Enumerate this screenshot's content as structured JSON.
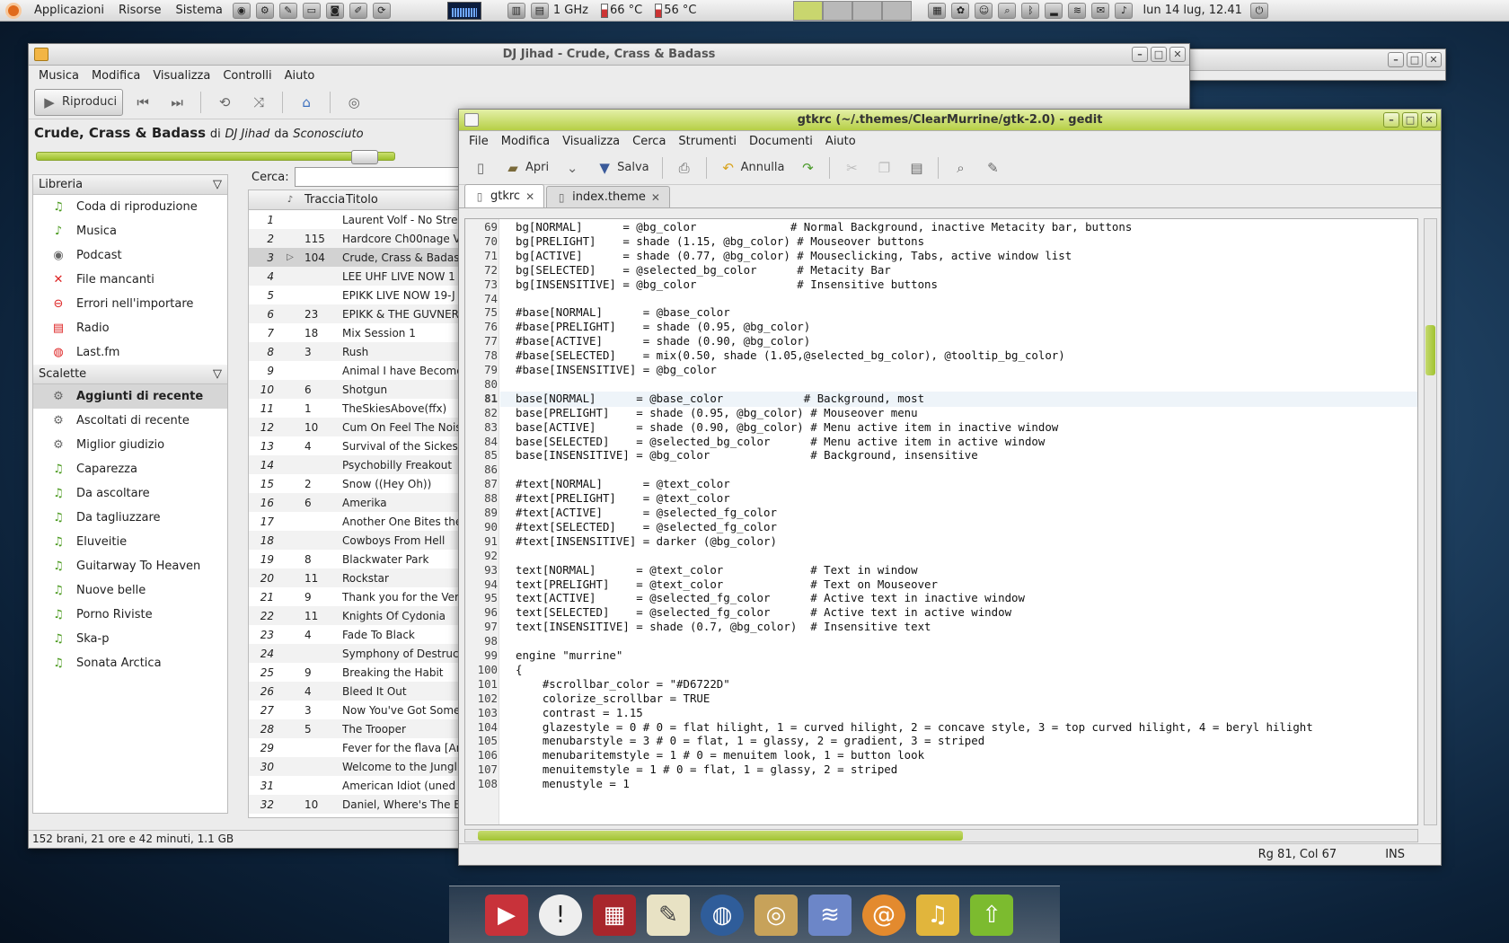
{
  "panel": {
    "menus": [
      "Applicazioni",
      "Risorse",
      "Sistema"
    ],
    "cpu": "1 GHz",
    "temp1": "66 °C",
    "temp2": "56 °C",
    "clock": "lun 14 lug, 12.41"
  },
  "rhythmbox": {
    "title": "DJ Jihad - Crude, Crass & Badass",
    "menu": [
      "Musica",
      "Modifica",
      "Visualizza",
      "Controlli",
      "Aiuto"
    ],
    "play_label": "Riproduci",
    "now_playing": {
      "song": "Crude, Crass & Badass",
      "by": "di",
      "artist": "DJ Jihad",
      "from": "da",
      "album": "Sconosciuto"
    },
    "library_header": "Libreria",
    "library": [
      {
        "label": "Coda di riproduzione",
        "icon": "queue-icon"
      },
      {
        "label": "Musica",
        "icon": "music-note-icon"
      },
      {
        "label": "Podcast",
        "icon": "podcast-icon"
      },
      {
        "label": "File mancanti",
        "icon": "missing-file-icon"
      },
      {
        "label": "Errori nell'importare",
        "icon": "error-icon"
      },
      {
        "label": "Radio",
        "icon": "radio-icon"
      },
      {
        "label": "Last.fm",
        "icon": "lastfm-icon"
      }
    ],
    "playlists_header": "Scalette",
    "playlists": [
      {
        "label": "Aggiunti di recente",
        "icon": "gear-icon",
        "selected": true
      },
      {
        "label": "Ascoltati di recente",
        "icon": "gear-icon"
      },
      {
        "label": "Miglior giudizio",
        "icon": "gear-icon"
      },
      {
        "label": "Caparezza",
        "icon": "playlist-icon"
      },
      {
        "label": "Da ascoltare",
        "icon": "playlist-icon"
      },
      {
        "label": "Da tagliuzzare",
        "icon": "playlist-icon"
      },
      {
        "label": "Eluveitie",
        "icon": "playlist-icon"
      },
      {
        "label": "Guitarway To Heaven",
        "icon": "playlist-icon"
      },
      {
        "label": "Nuove belle",
        "icon": "playlist-icon"
      },
      {
        "label": "Porno Riviste",
        "icon": "playlist-icon"
      },
      {
        "label": "Ska-p",
        "icon": "playlist-icon"
      },
      {
        "label": "Sonata Arctica",
        "icon": "playlist-icon"
      }
    ],
    "search_label": "Cerca:",
    "columns": {
      "track": "Traccia",
      "title": "Titolo"
    },
    "tracks": [
      {
        "n": "1",
        "track": "",
        "title": "Laurent Volf - No Stre"
      },
      {
        "n": "2",
        "track": "115",
        "title": "Hardcore Ch00nage V"
      },
      {
        "n": "3",
        "track": "104",
        "title": "Crude, Crass & Badas",
        "playing": true
      },
      {
        "n": "4",
        "track": "",
        "title": "LEE UHF LIVE NOW 1"
      },
      {
        "n": "5",
        "track": "",
        "title": "EPIKK LIVE NOW 19-J"
      },
      {
        "n": "6",
        "track": "23",
        "title": "EPIKK & THE GUVNER"
      },
      {
        "n": "7",
        "track": "18",
        "title": "Mix Session 1"
      },
      {
        "n": "8",
        "track": "3",
        "title": "Rush"
      },
      {
        "n": "9",
        "track": "",
        "title": "Animal I have Become"
      },
      {
        "n": "10",
        "track": "6",
        "title": "Shotgun"
      },
      {
        "n": "11",
        "track": "1",
        "title": "TheSkiesAbove(ffx)"
      },
      {
        "n": "12",
        "track": "10",
        "title": "Cum On Feel The Nois"
      },
      {
        "n": "13",
        "track": "4",
        "title": "Survival of the Sickes"
      },
      {
        "n": "14",
        "track": "",
        "title": "Psychobilly Freakout"
      },
      {
        "n": "15",
        "track": "2",
        "title": "Snow ((Hey Oh))"
      },
      {
        "n": "16",
        "track": "6",
        "title": "Amerika"
      },
      {
        "n": "17",
        "track": "",
        "title": "Another One Bites the"
      },
      {
        "n": "18",
        "track": "",
        "title": "Cowboys From Hell"
      },
      {
        "n": "19",
        "track": "8",
        "title": "Blackwater Park"
      },
      {
        "n": "20",
        "track": "11",
        "title": "Rockstar"
      },
      {
        "n": "21",
        "track": "9",
        "title": "Thank you for the Ver"
      },
      {
        "n": "22",
        "track": "11",
        "title": "Knights Of Cydonia"
      },
      {
        "n": "23",
        "track": "4",
        "title": "Fade To Black"
      },
      {
        "n": "24",
        "track": "",
        "title": "Symphony of Destruc"
      },
      {
        "n": "25",
        "track": "9",
        "title": "Breaking the Habit"
      },
      {
        "n": "26",
        "track": "4",
        "title": "Bleed It Out"
      },
      {
        "n": "27",
        "track": "3",
        "title": "Now You've Got Some"
      },
      {
        "n": "28",
        "track": "5",
        "title": "The Trooper"
      },
      {
        "n": "29",
        "track": "",
        "title": "Fever for the flava [Ar"
      },
      {
        "n": "30",
        "track": "",
        "title": "Welcome to the Jungl"
      },
      {
        "n": "31",
        "track": "",
        "title": "American Idiot (uned"
      },
      {
        "n": "32",
        "track": "10",
        "title": "Daniel, Where's The E"
      }
    ],
    "status": "152 brani, 21 ore e 42 minuti, 1.1 GB"
  },
  "gedit": {
    "title": "gtkrc (~/.themes/ClearMurrine/gtk-2.0) - gedit",
    "menu": [
      "File",
      "Modifica",
      "Visualizza",
      "Cerca",
      "Strumenti",
      "Documenti",
      "Aiuto"
    ],
    "toolbar": {
      "open": "Apri",
      "save": "Salva",
      "undo": "Annulla"
    },
    "tabs": [
      "gtkrc",
      "index.theme"
    ],
    "lines": [
      {
        "n": "69",
        "text": "bg[NORMAL]      = @bg_color              # Normal Background, inactive Metacity bar, buttons"
      },
      {
        "n": "70",
        "text": "bg[PRELIGHT]    = shade (1.15, @bg_color) # Mouseover buttons"
      },
      {
        "n": "71",
        "text": "bg[ACTIVE]      = shade (0.77, @bg_color) # Mouseclicking, Tabs, active window list"
      },
      {
        "n": "72",
        "text": "bg[SELECTED]    = @selected_bg_color      # Metacity Bar"
      },
      {
        "n": "73",
        "text": "bg[INSENSITIVE] = @bg_color               # Insensitive buttons"
      },
      {
        "n": "74",
        "text": ""
      },
      {
        "n": "75",
        "text": "#base[NORMAL]      = @base_color"
      },
      {
        "n": "76",
        "text": "#base[PRELIGHT]    = shade (0.95, @bg_color)"
      },
      {
        "n": "77",
        "text": "#base[ACTIVE]      = shade (0.90, @bg_color)"
      },
      {
        "n": "78",
        "text": "#base[SELECTED]    = mix(0.50, shade (1.05,@selected_bg_color), @tooltip_bg_color)"
      },
      {
        "n": "79",
        "text": "#base[INSENSITIVE] = @bg_color"
      },
      {
        "n": "80",
        "text": ""
      },
      {
        "n": "81",
        "text": "base[NORMAL]      = @base_color            # Background, most",
        "current": true
      },
      {
        "n": "82",
        "text": "base[PRELIGHT]    = shade (0.95, @bg_color) # Mouseover menu"
      },
      {
        "n": "83",
        "text": "base[ACTIVE]      = shade (0.90, @bg_color) # Menu active item in inactive window"
      },
      {
        "n": "84",
        "text": "base[SELECTED]    = @selected_bg_color      # Menu active item in active window"
      },
      {
        "n": "85",
        "text": "base[INSENSITIVE] = @bg_color               # Background, insensitive"
      },
      {
        "n": "86",
        "text": ""
      },
      {
        "n": "87",
        "text": "#text[NORMAL]      = @text_color"
      },
      {
        "n": "88",
        "text": "#text[PRELIGHT]    = @text_color"
      },
      {
        "n": "89",
        "text": "#text[ACTIVE]      = @selected_fg_color"
      },
      {
        "n": "90",
        "text": "#text[SELECTED]    = @selected_fg_color"
      },
      {
        "n": "91",
        "text": "#text[INSENSITIVE] = darker (@bg_color)"
      },
      {
        "n": "92",
        "text": ""
      },
      {
        "n": "93",
        "text": "text[NORMAL]      = @text_color             # Text in window"
      },
      {
        "n": "94",
        "text": "text[PRELIGHT]    = @text_color             # Text on Mouseover"
      },
      {
        "n": "95",
        "text": "text[ACTIVE]      = @selected_fg_color      # Active text in inactive window"
      },
      {
        "n": "96",
        "text": "text[SELECTED]    = @selected_fg_color      # Active text in active window"
      },
      {
        "n": "97",
        "text": "text[INSENSITIVE] = shade (0.7, @bg_color)  # Insensitive text"
      },
      {
        "n": "98",
        "text": ""
      },
      {
        "n": "99",
        "text": "engine \"murrine\""
      },
      {
        "n": "100",
        "text": "{"
      },
      {
        "n": "101",
        "text": "    #scrollbar_color = \"#D6722D\""
      },
      {
        "n": "102",
        "text": "    colorize_scrollbar = TRUE"
      },
      {
        "n": "103",
        "text": "    contrast = 1.15"
      },
      {
        "n": "104",
        "text": "    glazestyle = 0 # 0 = flat hilight, 1 = curved hilight, 2 = concave style, 3 = top curved hilight, 4 = beryl hilight"
      },
      {
        "n": "105",
        "text": "    menubarstyle = 3 # 0 = flat, 1 = glassy, 2 = gradient, 3 = striped"
      },
      {
        "n": "106",
        "text": "    menubaritemstyle = 1 # 0 = menuitem look, 1 = button look"
      },
      {
        "n": "107",
        "text": "    menuitemstyle = 1 # 0 = flat, 1 = glassy, 2 = striped"
      },
      {
        "n": "108",
        "text": "    menustyle = 1"
      }
    ],
    "status": {
      "position": "Rg 81, Col 67",
      "mode": "INS"
    }
  }
}
